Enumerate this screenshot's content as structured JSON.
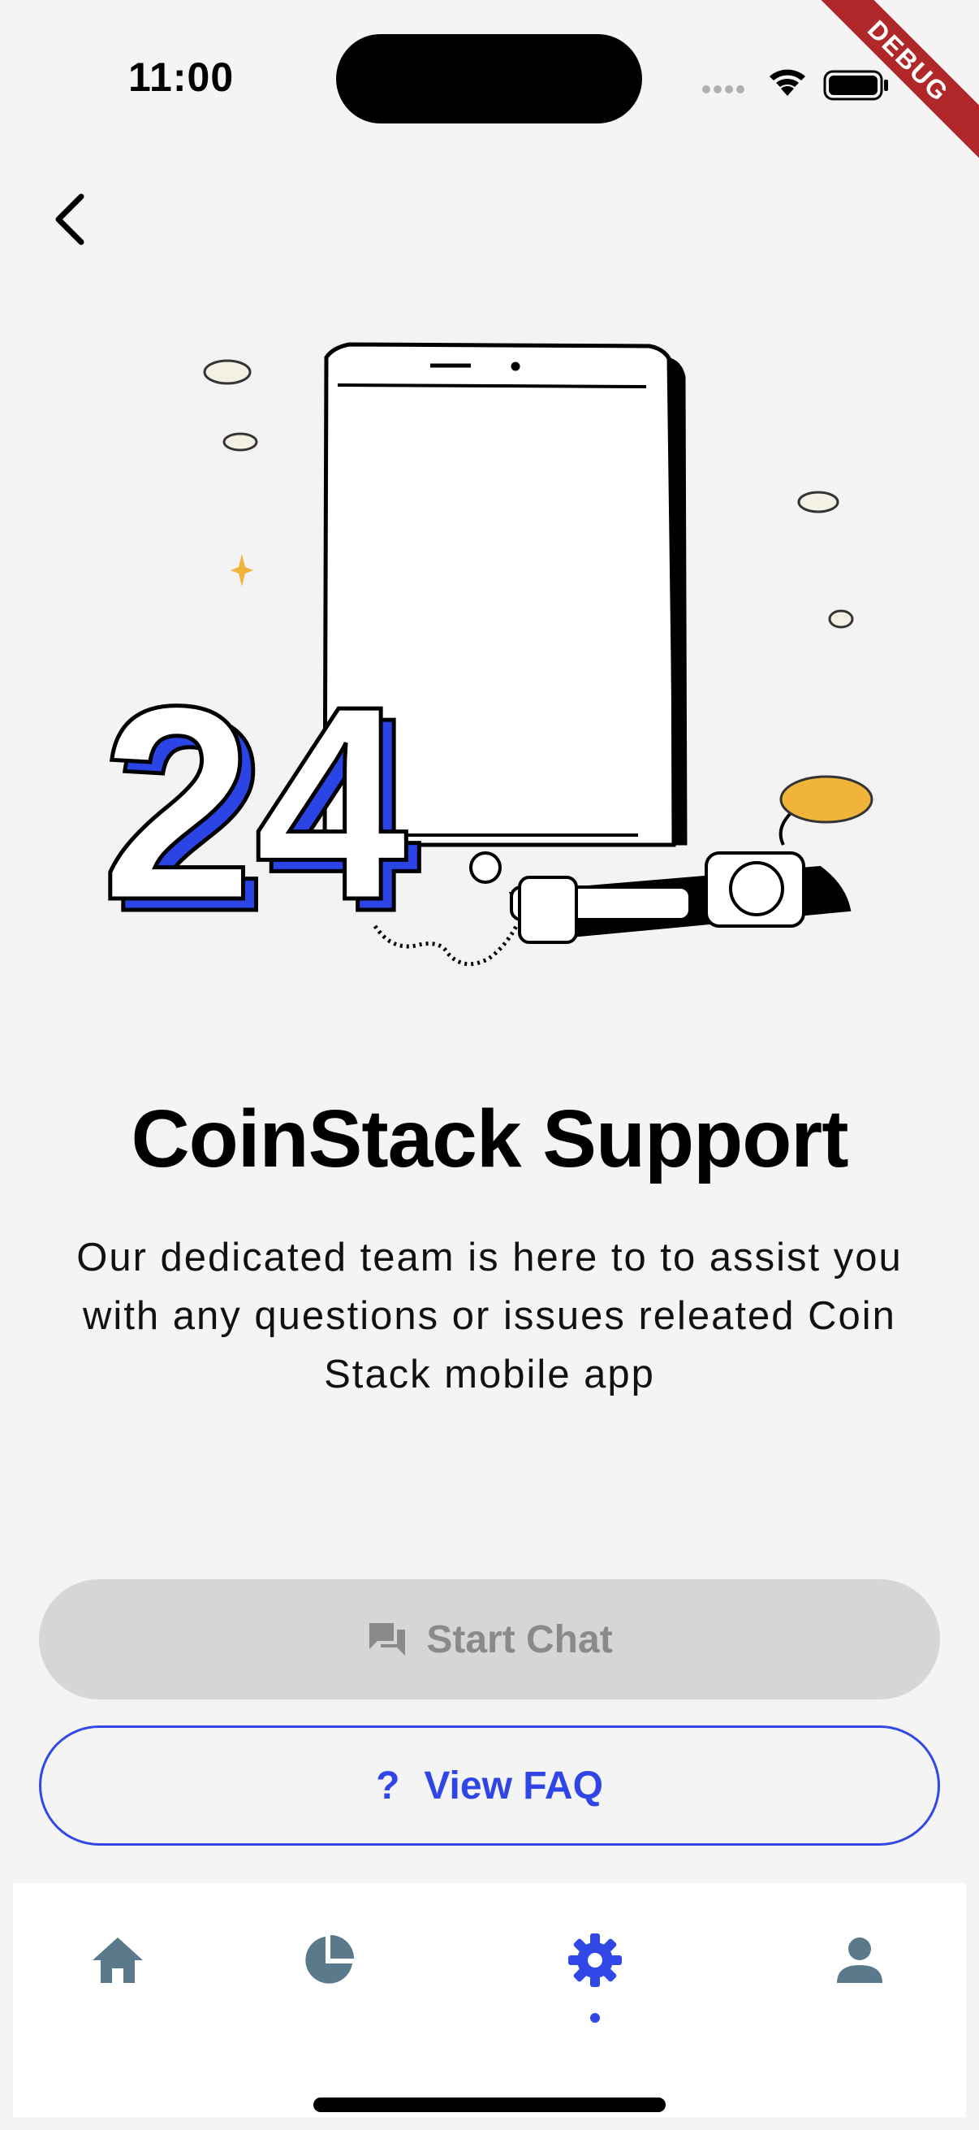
{
  "status_bar": {
    "time": "11:00",
    "debug_label": "DEBUG"
  },
  "page": {
    "title": "CoinStack Support",
    "description": "Our dedicated team is here to to assist you with any questions or issues releated Coin Stack mobile app"
  },
  "illustration": {
    "badge_text": "24"
  },
  "actions": {
    "start_chat_label": "Start Chat",
    "view_faq_label": "View FAQ",
    "faq_symbol": "?"
  },
  "bottom_nav": {
    "items": [
      {
        "icon": "home-icon",
        "active": false
      },
      {
        "icon": "pie-chart-icon",
        "active": false
      },
      {
        "icon": "gear-icon",
        "active": true
      },
      {
        "icon": "person-icon",
        "active": false
      }
    ]
  },
  "colors": {
    "accent": "#3148e6",
    "background": "#f4f4f5",
    "nav_inactive": "#5a7a8c",
    "disabled_button": "#d6d6d6",
    "disabled_text": "#8a8a8a"
  }
}
